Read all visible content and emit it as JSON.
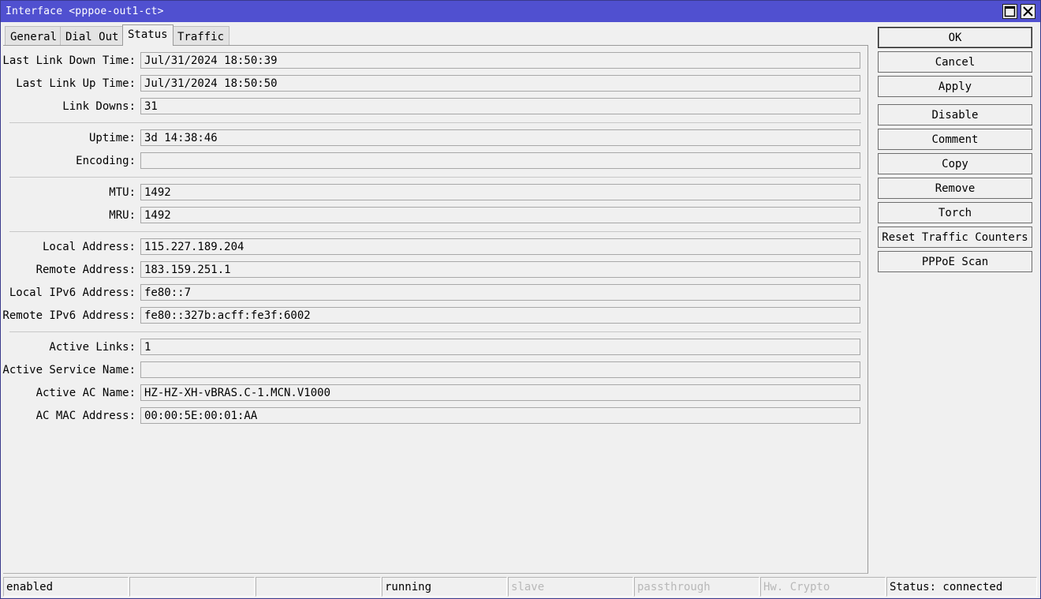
{
  "window": {
    "title": "Interface <pppoe-out1-ct>"
  },
  "tabs": [
    "General",
    "Dial Out",
    "Status",
    "Traffic"
  ],
  "active_tab": "Status",
  "fields": [
    {
      "label": "Last Link Down Time:",
      "value": "Jul/31/2024 18:50:39"
    },
    {
      "label": "Last Link Up Time:",
      "value": "Jul/31/2024 18:50:50"
    },
    {
      "label": "Link Downs:",
      "value": "31"
    },
    {
      "label": "Uptime:",
      "value": "3d 14:38:46"
    },
    {
      "label": "Encoding:",
      "value": ""
    },
    {
      "label": "MTU:",
      "value": "1492"
    },
    {
      "label": "MRU:",
      "value": "1492"
    },
    {
      "label": "Local Address:",
      "value": "115.227.189.204"
    },
    {
      "label": "Remote Address:",
      "value": "183.159.251.1"
    },
    {
      "label": "Local IPv6 Address:",
      "value": "fe80::7"
    },
    {
      "label": "Remote IPv6 Address:",
      "value": "fe80::327b:acff:fe3f:6002"
    },
    {
      "label": "Active Links:",
      "value": "1"
    },
    {
      "label": "Active Service Name:",
      "value": ""
    },
    {
      "label": "Active AC Name:",
      "value": "HZ-HZ-XH-vBRAS.C-1.MCN.V1000"
    },
    {
      "label": "AC MAC Address:",
      "value": "00:00:5E:00:01:AA"
    }
  ],
  "buttons": [
    "OK",
    "Cancel",
    "Apply",
    "Disable",
    "Comment",
    "Copy",
    "Remove",
    "Torch",
    "Reset Traffic Counters",
    "PPPoE Scan"
  ],
  "statusbar": [
    "enabled",
    "",
    "",
    "running",
    "slave",
    "passthrough",
    "Hw. Crypto",
    "Status: connected"
  ],
  "colors": {
    "titlebar": "#5050d0",
    "background": "#f0f0f0",
    "dim_text": "#b8b8b8"
  }
}
